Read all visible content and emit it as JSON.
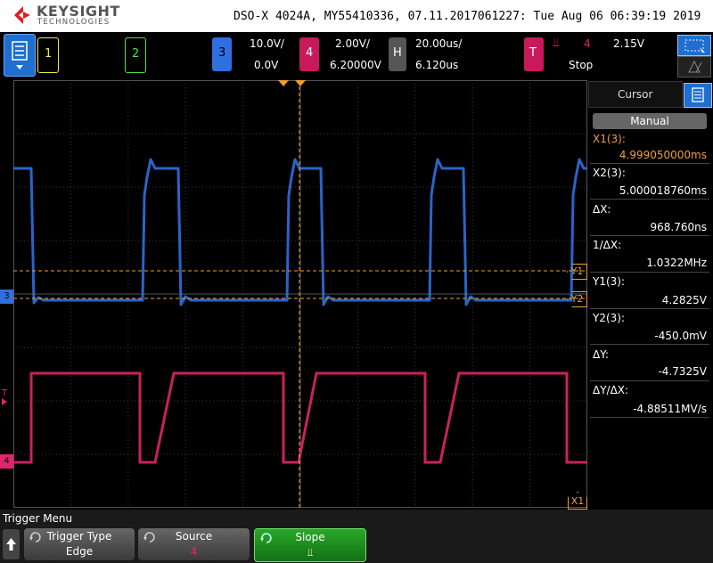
{
  "header": {
    "brand": "KEYSIGHT",
    "brand_sub": "TECHNOLOGIES",
    "info": "DSO-X 4024A, MY55410336, 07.11.2017061227: Tue Aug 06 06:39:19 2019"
  },
  "channels": [
    {
      "num": "1",
      "color": "#f5e84a"
    },
    {
      "num": "2",
      "color": "#4ee04e"
    },
    {
      "num": "3",
      "color": "#2f6fe0",
      "scale": "10.0V/",
      "offset": "0.0V"
    },
    {
      "num": "4",
      "color": "#e0246f",
      "scale": "2.00V/",
      "offset": "6.20000V"
    }
  ],
  "horizontal": {
    "label": "H",
    "scale": "20.00us/",
    "position": "6.120us"
  },
  "trigger": {
    "label": "T",
    "source": "4",
    "level": "2.15V",
    "state": "Stop",
    "slope_symbol": "⫫"
  },
  "cursor_panel": {
    "title": "Cursor",
    "mode": "Manual",
    "x1_label": "X1(3):",
    "x1_value": "4.999050000ms",
    "x2_label": "X2(3):",
    "x2_value": "5.000018760ms",
    "dx_label": "ΔX:",
    "dx_value": "968.760ns",
    "inv_dx_label": "1/ΔX:",
    "inv_dx_value": "1.0322MHz",
    "y1_label": "Y1(3):",
    "y1_value": "4.2825V",
    "y2_label": "Y2(3):",
    "y2_value": "-450.0mV",
    "dy_label": "ΔY:",
    "dy_value": "-4.7325V",
    "dydx_label": "ΔY/ΔX:",
    "dydx_value": "-4.88511MV/s"
  },
  "markers": {
    "y1": "Y1",
    "y2": "Y2",
    "x1": "X1",
    "t": "T",
    "ch3": "3",
    "ch4": "4"
  },
  "menu": {
    "title": "Trigger Menu",
    "softkeys": [
      {
        "label": "Trigger Type",
        "value": "Edge"
      },
      {
        "label": "Source",
        "value": "4"
      },
      {
        "label": "Slope",
        "value": "⫫"
      }
    ]
  },
  "colors": {
    "ch3": "#2f6fe0",
    "ch4": "#e0246f",
    "cursor": "#f0a030",
    "grid": "#3a3a3a",
    "accent": "#1e6fd0",
    "softkey_active": "#1f8a1f"
  }
}
